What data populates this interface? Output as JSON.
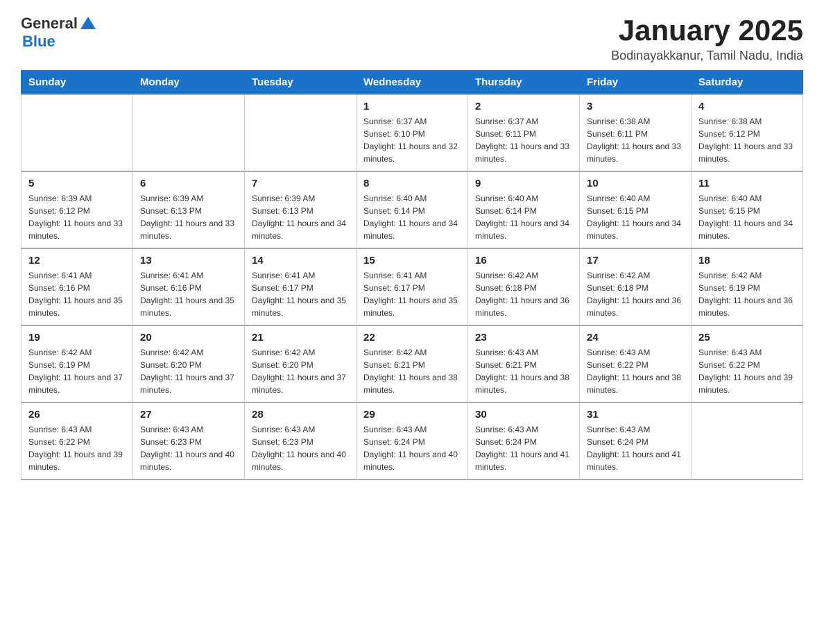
{
  "logo": {
    "text_general": "General",
    "text_blue": "Blue"
  },
  "title": "January 2025",
  "location": "Bodinayakkanur, Tamil Nadu, India",
  "days_of_week": [
    "Sunday",
    "Monday",
    "Tuesday",
    "Wednesday",
    "Thursday",
    "Friday",
    "Saturday"
  ],
  "weeks": [
    [
      {
        "day": "",
        "info": ""
      },
      {
        "day": "",
        "info": ""
      },
      {
        "day": "",
        "info": ""
      },
      {
        "day": "1",
        "info": "Sunrise: 6:37 AM\nSunset: 6:10 PM\nDaylight: 11 hours and 32 minutes."
      },
      {
        "day": "2",
        "info": "Sunrise: 6:37 AM\nSunset: 6:11 PM\nDaylight: 11 hours and 33 minutes."
      },
      {
        "day": "3",
        "info": "Sunrise: 6:38 AM\nSunset: 6:11 PM\nDaylight: 11 hours and 33 minutes."
      },
      {
        "day": "4",
        "info": "Sunrise: 6:38 AM\nSunset: 6:12 PM\nDaylight: 11 hours and 33 minutes."
      }
    ],
    [
      {
        "day": "5",
        "info": "Sunrise: 6:39 AM\nSunset: 6:12 PM\nDaylight: 11 hours and 33 minutes."
      },
      {
        "day": "6",
        "info": "Sunrise: 6:39 AM\nSunset: 6:13 PM\nDaylight: 11 hours and 33 minutes."
      },
      {
        "day": "7",
        "info": "Sunrise: 6:39 AM\nSunset: 6:13 PM\nDaylight: 11 hours and 34 minutes."
      },
      {
        "day": "8",
        "info": "Sunrise: 6:40 AM\nSunset: 6:14 PM\nDaylight: 11 hours and 34 minutes."
      },
      {
        "day": "9",
        "info": "Sunrise: 6:40 AM\nSunset: 6:14 PM\nDaylight: 11 hours and 34 minutes."
      },
      {
        "day": "10",
        "info": "Sunrise: 6:40 AM\nSunset: 6:15 PM\nDaylight: 11 hours and 34 minutes."
      },
      {
        "day": "11",
        "info": "Sunrise: 6:40 AM\nSunset: 6:15 PM\nDaylight: 11 hours and 34 minutes."
      }
    ],
    [
      {
        "day": "12",
        "info": "Sunrise: 6:41 AM\nSunset: 6:16 PM\nDaylight: 11 hours and 35 minutes."
      },
      {
        "day": "13",
        "info": "Sunrise: 6:41 AM\nSunset: 6:16 PM\nDaylight: 11 hours and 35 minutes."
      },
      {
        "day": "14",
        "info": "Sunrise: 6:41 AM\nSunset: 6:17 PM\nDaylight: 11 hours and 35 minutes."
      },
      {
        "day": "15",
        "info": "Sunrise: 6:41 AM\nSunset: 6:17 PM\nDaylight: 11 hours and 35 minutes."
      },
      {
        "day": "16",
        "info": "Sunrise: 6:42 AM\nSunset: 6:18 PM\nDaylight: 11 hours and 36 minutes."
      },
      {
        "day": "17",
        "info": "Sunrise: 6:42 AM\nSunset: 6:18 PM\nDaylight: 11 hours and 36 minutes."
      },
      {
        "day": "18",
        "info": "Sunrise: 6:42 AM\nSunset: 6:19 PM\nDaylight: 11 hours and 36 minutes."
      }
    ],
    [
      {
        "day": "19",
        "info": "Sunrise: 6:42 AM\nSunset: 6:19 PM\nDaylight: 11 hours and 37 minutes."
      },
      {
        "day": "20",
        "info": "Sunrise: 6:42 AM\nSunset: 6:20 PM\nDaylight: 11 hours and 37 minutes."
      },
      {
        "day": "21",
        "info": "Sunrise: 6:42 AM\nSunset: 6:20 PM\nDaylight: 11 hours and 37 minutes."
      },
      {
        "day": "22",
        "info": "Sunrise: 6:42 AM\nSunset: 6:21 PM\nDaylight: 11 hours and 38 minutes."
      },
      {
        "day": "23",
        "info": "Sunrise: 6:43 AM\nSunset: 6:21 PM\nDaylight: 11 hours and 38 minutes."
      },
      {
        "day": "24",
        "info": "Sunrise: 6:43 AM\nSunset: 6:22 PM\nDaylight: 11 hours and 38 minutes."
      },
      {
        "day": "25",
        "info": "Sunrise: 6:43 AM\nSunset: 6:22 PM\nDaylight: 11 hours and 39 minutes."
      }
    ],
    [
      {
        "day": "26",
        "info": "Sunrise: 6:43 AM\nSunset: 6:22 PM\nDaylight: 11 hours and 39 minutes."
      },
      {
        "day": "27",
        "info": "Sunrise: 6:43 AM\nSunset: 6:23 PM\nDaylight: 11 hours and 40 minutes."
      },
      {
        "day": "28",
        "info": "Sunrise: 6:43 AM\nSunset: 6:23 PM\nDaylight: 11 hours and 40 minutes."
      },
      {
        "day": "29",
        "info": "Sunrise: 6:43 AM\nSunset: 6:24 PM\nDaylight: 11 hours and 40 minutes."
      },
      {
        "day": "30",
        "info": "Sunrise: 6:43 AM\nSunset: 6:24 PM\nDaylight: 11 hours and 41 minutes."
      },
      {
        "day": "31",
        "info": "Sunrise: 6:43 AM\nSunset: 6:24 PM\nDaylight: 11 hours and 41 minutes."
      },
      {
        "day": "",
        "info": ""
      }
    ]
  ]
}
